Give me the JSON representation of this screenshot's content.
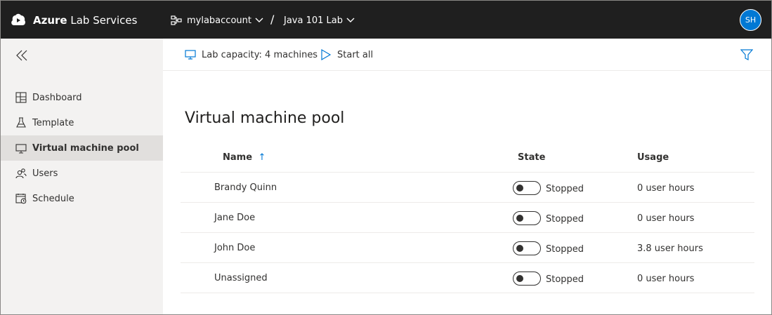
{
  "header": {
    "app_title_bold": "Azure",
    "app_title_rest": " Lab Services",
    "account": "mylabaccount",
    "separator": "/",
    "lab": "Java 101 Lab",
    "user_initials": "SH"
  },
  "sidebar": {
    "items": [
      {
        "label": "Dashboard",
        "icon": "dashboard-icon"
      },
      {
        "label": "Template",
        "icon": "flask-icon"
      },
      {
        "label": "Virtual machine pool",
        "icon": "monitor-icon",
        "active": true
      },
      {
        "label": "Users",
        "icon": "users-icon"
      },
      {
        "label": "Schedule",
        "icon": "calendar-icon"
      }
    ]
  },
  "commandbar": {
    "capacity": "Lab capacity: 4 machines",
    "start_all": "Start all"
  },
  "main": {
    "title": "Virtual machine pool",
    "columns": {
      "name": "Name",
      "sort_indicator": "↑",
      "state": "State",
      "usage": "Usage"
    },
    "rows": [
      {
        "name": "Brandy Quinn",
        "state": "Stopped",
        "usage": "0 user hours"
      },
      {
        "name": "Jane Doe",
        "state": "Stopped",
        "usage": "0 user hours"
      },
      {
        "name": "John Doe",
        "state": "Stopped",
        "usage": "3.8 user hours"
      },
      {
        "name": "Unassigned",
        "state": "Stopped",
        "usage": "0 user hours"
      }
    ]
  },
  "colors": {
    "topbar": "#1f1f1f",
    "accent": "#0078d4",
    "sidebar": "#f3f2f1",
    "sidebar_active": "#e1dfdd"
  }
}
